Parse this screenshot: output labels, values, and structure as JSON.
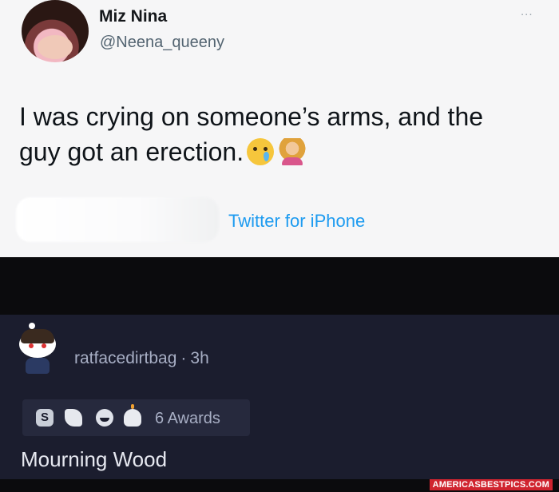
{
  "tweet": {
    "display_name": "Miz Nina",
    "handle": "@Neena_queeny",
    "more_label": "...",
    "text": "I was crying on someone’s arms, and the guy got an erection.",
    "emojis": [
      "crying-face",
      "woman-facepalming"
    ],
    "source": "Twitter for iPhone"
  },
  "comment": {
    "username": "ratfacedirtbag",
    "separator": "·",
    "age": "3h",
    "award_icons": [
      "silver-award-icon",
      "wholesome-award-icon",
      "haha-award-icon",
      "cake-award-icon"
    ],
    "silver_glyph": "S",
    "awards_label": "6 Awards",
    "body": "Mourning Wood"
  },
  "watermark": "AMERICASBESTPICS.COM",
  "colors": {
    "tweet_bg": "#f6f6f7",
    "link_blue": "#1d9bf0",
    "comment_bg": "#1b1d2e",
    "watermark_red": "#d0242f"
  }
}
